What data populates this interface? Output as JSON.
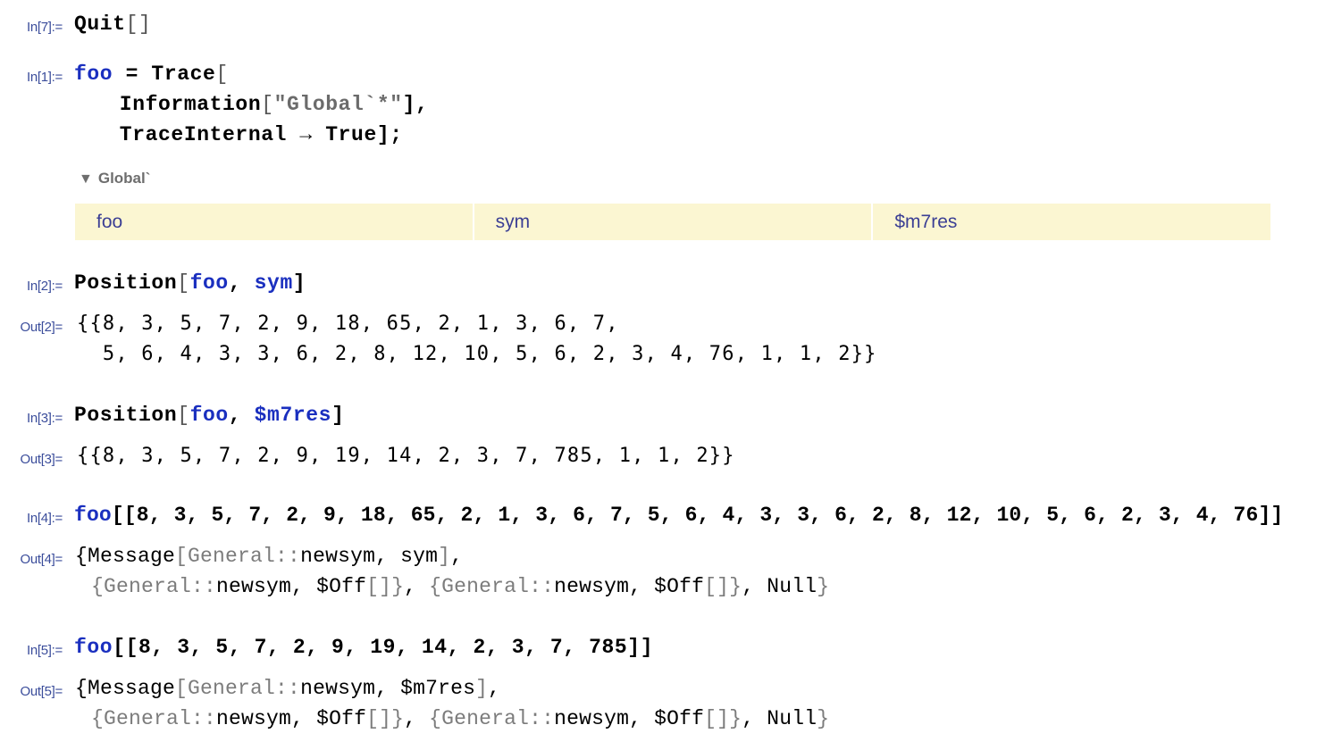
{
  "cells": [
    {
      "label": "In[7]:=",
      "lines": [
        [
          {
            "t": "Quit"
          },
          {
            "t": "[]",
            "c": "bkt"
          }
        ]
      ]
    },
    {
      "label": "In[1]:=",
      "lines": [
        [
          {
            "t": "foo",
            "c": "blue"
          },
          {
            "t": " = Trace"
          },
          {
            "t": "[",
            "c": "bkt"
          }
        ],
        [
          {
            "t": "  Information"
          },
          {
            "t": "[",
            "c": "bkt"
          },
          {
            "t": "\"Global`*\"",
            "c": "str"
          },
          {
            "t": "],"
          }
        ],
        [
          {
            "t": "  TraceInternal → True"
          },
          {
            "t": "];"
          }
        ]
      ]
    },
    {
      "label": "In[2]:=",
      "lines": [
        [
          {
            "t": "Position"
          },
          {
            "t": "[",
            "c": "bkt"
          },
          {
            "t": "foo",
            "c": "blue"
          },
          {
            "t": ", "
          },
          {
            "t": "sym",
            "c": "blue"
          },
          {
            "t": "]"
          }
        ]
      ]
    },
    {
      "label": "Out[2]=",
      "lines": [
        [
          {
            "t": "{{8, 3, 5, 7, 2, 9, 18, 65, 2, 1, 3, 6, 7,"
          }
        ],
        [
          {
            "t": "  5, 6, 4, 3, 3, 6, 2, 8, 12, 10, 5, 6, 2, 3, 4, 76, 1, 1, 2}}"
          }
        ]
      ]
    },
    {
      "label": "In[3]:=",
      "lines": [
        [
          {
            "t": "Position"
          },
          {
            "t": "[",
            "c": "bkt"
          },
          {
            "t": "foo",
            "c": "blue"
          },
          {
            "t": ", "
          },
          {
            "t": "$m7res",
            "c": "blue"
          },
          {
            "t": "]"
          }
        ]
      ]
    },
    {
      "label": "Out[3]=",
      "lines": [
        [
          {
            "t": "{{8, 3, 5, 7, 2, 9, 19, 14, 2, 3, 7, 785, 1, 1, 2}}"
          }
        ]
      ]
    },
    {
      "label": "In[4]:=",
      "lines": [
        [
          {
            "t": "foo",
            "c": "blue"
          },
          {
            "t": "[[8, 3, 5, 7, 2, 9, 18, 65, 2, 1, 3, 6, 7, 5, 6, 4, 3, 3, 6, 2, 8, 12, 10, 5, 6, 2, 3, 4, 76]]"
          }
        ]
      ]
    },
    {
      "label": "Out[4]=",
      "lines": [
        [
          {
            "t": "{Message"
          },
          {
            "t": "[General::",
            "c": "gray"
          },
          {
            "t": "newsym, sym"
          },
          {
            "t": "]",
            "c": "gray"
          },
          {
            "t": ","
          }
        ],
        [
          {
            "t": " {",
            "c": "gray"
          },
          {
            "t": "General::",
            "c": "gray"
          },
          {
            "t": "newsym, $Off"
          },
          {
            "t": "[]}",
            "c": "gray"
          },
          {
            "t": ", "
          },
          {
            "t": "{General::",
            "c": "gray"
          },
          {
            "t": "newsym, $Off"
          },
          {
            "t": "[]}",
            "c": "gray"
          },
          {
            "t": ", Null"
          },
          {
            "t": "}",
            "c": "gray"
          }
        ]
      ]
    },
    {
      "label": "In[5]:=",
      "lines": [
        [
          {
            "t": "foo",
            "c": "blue"
          },
          {
            "t": "[[8, 3, 5, 7, 2, 9, 19, 14, 2, 3, 7, 785]]"
          }
        ]
      ]
    },
    {
      "label": "Out[5]=",
      "lines": [
        [
          {
            "t": "{Message"
          },
          {
            "t": "[General::",
            "c": "gray"
          },
          {
            "t": "newsym, $m7res"
          },
          {
            "t": "]",
            "c": "gray"
          },
          {
            "t": ","
          }
        ],
        [
          {
            "t": " {",
            "c": "gray"
          },
          {
            "t": "General::",
            "c": "gray"
          },
          {
            "t": "newsym, $Off"
          },
          {
            "t": "[]}",
            "c": "gray"
          },
          {
            "t": ", "
          },
          {
            "t": "{General::",
            "c": "gray"
          },
          {
            "t": "newsym, $Off"
          },
          {
            "t": "[]}",
            "c": "gray"
          },
          {
            "t": ", Null"
          },
          {
            "t": "}",
            "c": "gray"
          }
        ]
      ]
    }
  ],
  "information_panel": {
    "header": "Global`",
    "toggle_icon": "triangle-down-icon",
    "symbols": [
      "foo",
      "sym",
      "$m7res"
    ]
  },
  "colors": {
    "label": "#3b4d9b",
    "symbol_blue": "#1a2fbf",
    "info_background": "#fbf6d2",
    "info_text": "#3b3f94",
    "gray_text": "#7c7c7c"
  }
}
